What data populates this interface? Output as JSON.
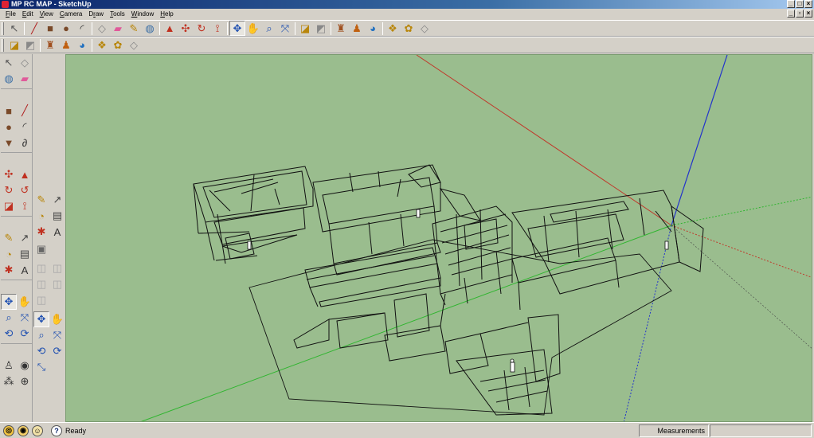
{
  "window": {
    "title": "MP RC MAP - SketchUp"
  },
  "menu": [
    {
      "pre": "",
      "u": "F",
      "post": "ile"
    },
    {
      "pre": "",
      "u": "E",
      "post": "dit"
    },
    {
      "pre": "",
      "u": "V",
      "post": "iew"
    },
    {
      "pre": "",
      "u": "C",
      "post": "amera"
    },
    {
      "pre": "D",
      "u": "r",
      "post": "aw"
    },
    {
      "pre": "",
      "u": "T",
      "post": "ools"
    },
    {
      "pre": "",
      "u": "W",
      "post": "indow"
    },
    {
      "pre": "",
      "u": "H",
      "post": "elp"
    }
  ],
  "toolbar_icons": [
    "select-icon",
    "pencil-icon",
    "rectangle-icon",
    "circle-icon",
    "arc-icon",
    "eraser-icon",
    "paint-bucket-icon",
    "move-icon",
    "push-pull-icon",
    "rotate-icon",
    "follow-me-icon",
    "offset-icon",
    "orbit-icon",
    "pan-icon",
    "zoom-icon",
    "zoom-extents-icon",
    "section-plane-icon",
    "tape-measure-icon"
  ],
  "status": {
    "text": "Ready",
    "measurements_label": "Measurements",
    "measurements_value": ""
  },
  "colors": {
    "viewport": "#9abd8e",
    "edges": "#101010",
    "axis_red": "#c0392b",
    "axis_green": "#2fb52f",
    "axis_blue": "#2233cc"
  }
}
